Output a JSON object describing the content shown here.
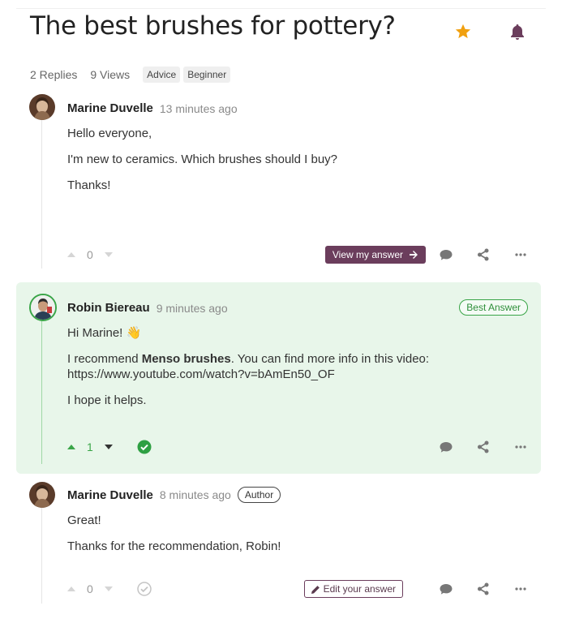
{
  "topic": {
    "title": "The best brushes for pottery?",
    "replies": "2 Replies",
    "views": "9 Views",
    "tags": [
      "Advice",
      "Beginner"
    ]
  },
  "icons": {
    "star": "star-icon",
    "bell": "bell-icon",
    "upvote": "caret-up-icon",
    "downvote": "caret-down-icon",
    "comment": "comment-icon",
    "share": "share-icon",
    "more": "ellipsis-icon",
    "accept": "check-circle-icon",
    "edit": "pencil-icon",
    "arrow": "arrow-right-icon"
  },
  "colors": {
    "accent": "#6b3d5c",
    "star": "#f0a010",
    "best_bg": "#e8f6ea",
    "best_border": "#3aa548"
  },
  "posts": [
    {
      "author": "Marine Duvelle",
      "time": "13 minutes ago",
      "paragraphs": [
        "Hello everyone,",
        "I'm new to ceramics. Which brushes should I buy?",
        "Thanks!"
      ],
      "votes": "0",
      "action_label": "View my answer"
    },
    {
      "author": "Robin Biereau",
      "time": "9 minutes ago",
      "badge": "Best Answer",
      "greeting": "Hi Marine! 👋",
      "recommend_prefix": "I recommend ",
      "recommend_bold": "Menso brushes",
      "recommend_suffix": ". You can find more info in this video:",
      "link": "https://www.youtube.com/watch?v=bAmEn50_OF",
      "closing": "I hope it helps.",
      "votes": "1"
    },
    {
      "author": "Marine Duvelle",
      "time": "8 minutes ago",
      "badge": "Author",
      "paragraphs": [
        "Great!",
        "Thanks for the recommendation, Robin!"
      ],
      "votes": "0",
      "action_label": "Edit your answer"
    }
  ]
}
